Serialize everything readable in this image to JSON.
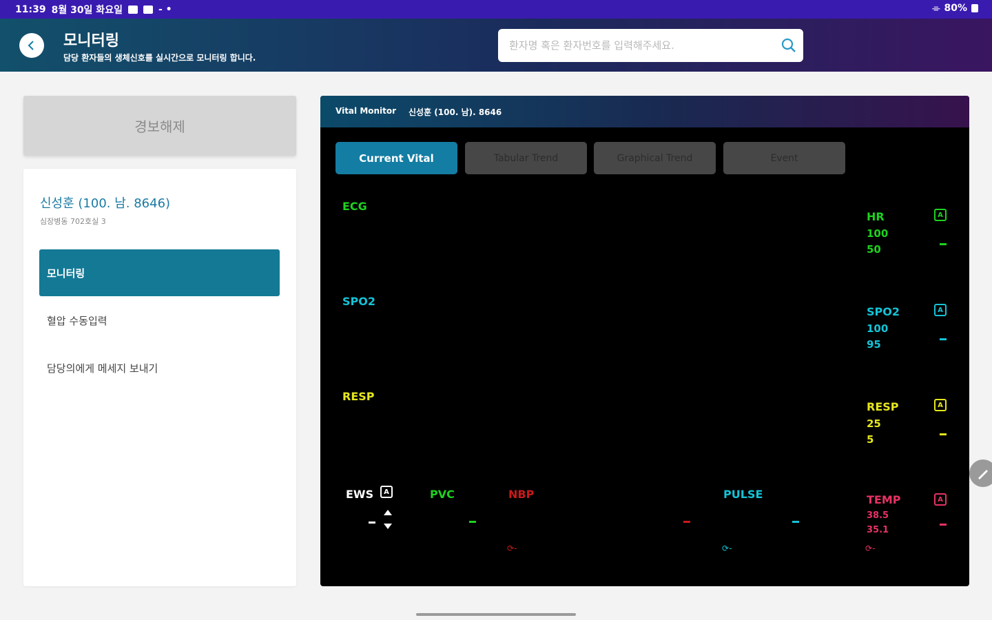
{
  "status_bar": {
    "time": "11:39",
    "date": "8월 30일 화요일",
    "battery": "80%"
  },
  "header": {
    "title": "모니터링",
    "subtitle": "담당 환자들의 생체신호를 실시간으로 모니터링 합니다.",
    "search_placeholder": "환자명 혹은 환자번호를 입력해주세요."
  },
  "left_panel": {
    "alarm_button": "경보해제",
    "patient_name": "신성훈 (100. 남. 8646)",
    "patient_ward": "심장병동 702호실 3",
    "menu": [
      {
        "label": "모니터링",
        "active": true
      },
      {
        "label": "혈압 수동입력",
        "active": false
      },
      {
        "label": "담당의에게 메세지 보내기",
        "active": false
      }
    ]
  },
  "monitor": {
    "title": "Vital Monitor",
    "patient": "신성훈 (100. 남). 8646",
    "tabs": [
      {
        "label": "Current Vital",
        "active": true
      },
      {
        "label": "Tabular Trend",
        "active": false
      },
      {
        "label": "Graphical Trend",
        "active": false
      },
      {
        "label": "Event",
        "active": false
      }
    ],
    "waves": {
      "ecg": "ECG",
      "spo2": "SPO2",
      "resp": "RESP"
    },
    "params": {
      "hr": {
        "label": "HR",
        "high": "100",
        "low": "50",
        "value": "-"
      },
      "spo2": {
        "label": "SPO2",
        "high": "100",
        "low": "95",
        "value": "-"
      },
      "resp": {
        "label": "RESP",
        "high": "25",
        "low": "5",
        "value": "-"
      },
      "temp": {
        "label": "TEMP",
        "high": "38.5",
        "low": "35.1",
        "value": "-"
      }
    },
    "bottom": {
      "ews": "EWS",
      "pvc": "PVC",
      "nbp": "NBP",
      "pulse": "PULSE",
      "cycle_suffix": "-"
    },
    "alarm_icon": "A",
    "colors": {
      "ecg": "#1ed21e",
      "spo2": "#14c3d7",
      "resp": "#e6e61e",
      "nbp": "#c81a1a",
      "temp": "#e63264"
    }
  }
}
